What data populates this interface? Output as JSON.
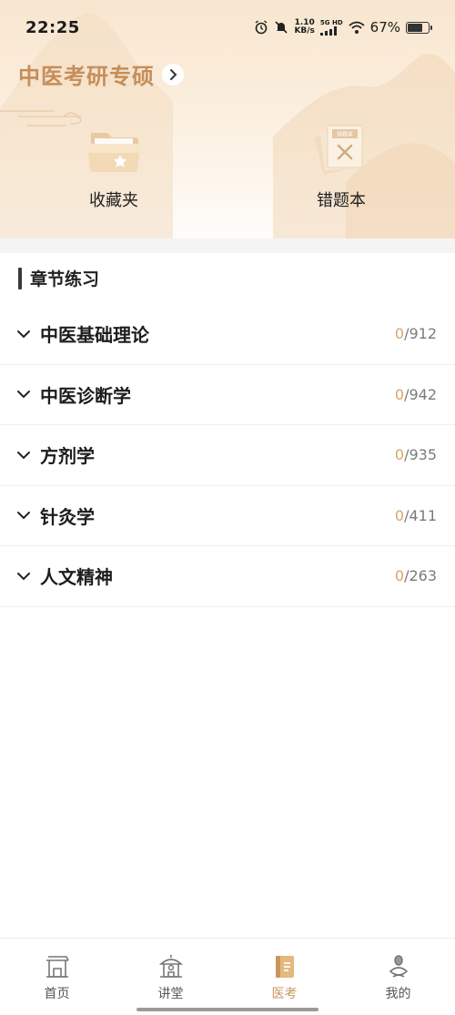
{
  "status_bar": {
    "time": "22:25",
    "speed_value": "1.10",
    "speed_unit": "KB/s",
    "network_top": "5G HD",
    "battery": "67%",
    "battery_level": 0.67
  },
  "header": {
    "title": "中医考研专硕"
  },
  "shortcuts": [
    {
      "label": "收藏夹",
      "icon": "folder-star-icon"
    },
    {
      "label": "错题本",
      "icon": "wrong-notebook-icon",
      "icon_text": "错题本"
    }
  ],
  "section": {
    "title": "章节练习"
  },
  "chapters": [
    {
      "name": "中医基础理论",
      "done": "0",
      "total": "/912"
    },
    {
      "name": "中医诊断学",
      "done": "0",
      "total": "/942"
    },
    {
      "name": "方剂学",
      "done": "0",
      "total": "/935"
    },
    {
      "name": "针灸学",
      "done": "0",
      "total": "/411"
    },
    {
      "name": "人文精神",
      "done": "0",
      "total": "/263"
    }
  ],
  "bottom_nav": [
    {
      "label": "首页",
      "icon": "home-gate-icon",
      "active": false
    },
    {
      "label": "讲堂",
      "icon": "lecture-hall-icon",
      "active": false
    },
    {
      "label": "医考",
      "icon": "medical-exam-book-icon",
      "active": true
    },
    {
      "label": "我的",
      "icon": "profile-icon",
      "active": false
    }
  ],
  "colors": {
    "accent": "#c8955f",
    "title": "#c58e5a",
    "progress_done": "#d9a56a"
  }
}
